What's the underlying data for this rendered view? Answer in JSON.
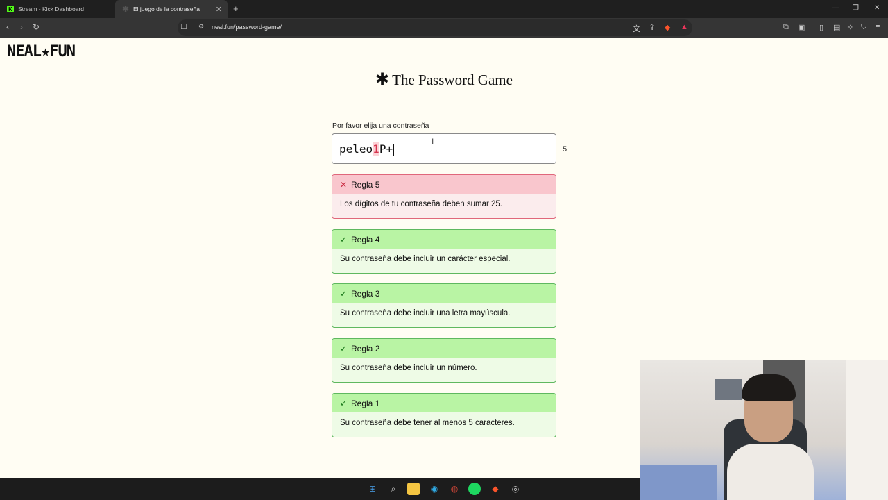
{
  "browser": {
    "tabs": [
      {
        "label": "Stream - Kick Dashboard",
        "icon": "kick-icon"
      },
      {
        "label": "El juego de la contraseña",
        "icon": "asterisk-icon",
        "active": true
      }
    ],
    "url": "neal.fun/password-game/"
  },
  "page": {
    "logo": "NEAL★FUN",
    "title": "The Password Game",
    "prompt": "Por favor elija una contraseña",
    "password_before": "peleo",
    "password_highlight": "1",
    "password_after": "P+",
    "char_count": "5"
  },
  "rules": [
    {
      "title": "Regla 5",
      "text": "Los dígitos de tu contraseña deben sumar 25.",
      "status": "fail"
    },
    {
      "title": "Regla 4",
      "text": "Su contraseña debe incluir un carácter especial.",
      "status": "pass"
    },
    {
      "title": "Regla 3",
      "text": "Su contraseña debe incluir una letra mayúscula.",
      "status": "pass"
    },
    {
      "title": "Regla 2",
      "text": "Su contraseña debe incluir un número.",
      "status": "pass"
    },
    {
      "title": "Regla 1",
      "text": "Su contraseña debe tener al menos 5 caracteres.",
      "status": "pass"
    }
  ],
  "colors": {
    "fail_header": "#f9c6cd",
    "fail_border": "#e0677b",
    "pass_header": "#b9f4a4",
    "pass_border": "#5fb85f",
    "page_bg": "#fffdf3"
  }
}
